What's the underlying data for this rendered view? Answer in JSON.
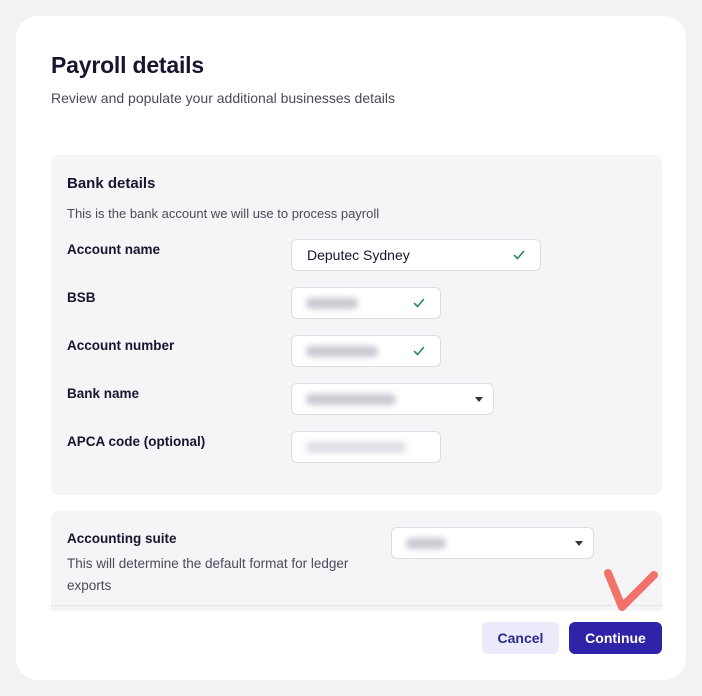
{
  "header": {
    "title": "Payroll details",
    "subtitle": "Review and populate your additional businesses details"
  },
  "bank_details": {
    "title": "Bank details",
    "description": "This is the bank account we will use to process payroll",
    "fields": [
      {
        "label": "Account name",
        "value": "Deputec Sydney",
        "validated": true
      },
      {
        "label": "BSB",
        "value": "",
        "validated": true,
        "redacted": true
      },
      {
        "label": "Account number",
        "value": "",
        "validated": true,
        "redacted": true
      },
      {
        "label": "Bank name",
        "value": "",
        "type": "select",
        "redacted": true
      },
      {
        "label": "APCA code (optional)",
        "value": "",
        "redacted": true
      }
    ]
  },
  "accounting": {
    "label": "Accounting suite",
    "description": "This will determine the default format for ledger exports",
    "value": "",
    "redacted": true
  },
  "footer": {
    "cancel_label": "Cancel",
    "continue_label": "Continue"
  },
  "colors": {
    "primary": "#2f23a8",
    "secondary_bg": "#ebeafb",
    "check": "#2e8b57",
    "annotation": "#f2716b"
  }
}
